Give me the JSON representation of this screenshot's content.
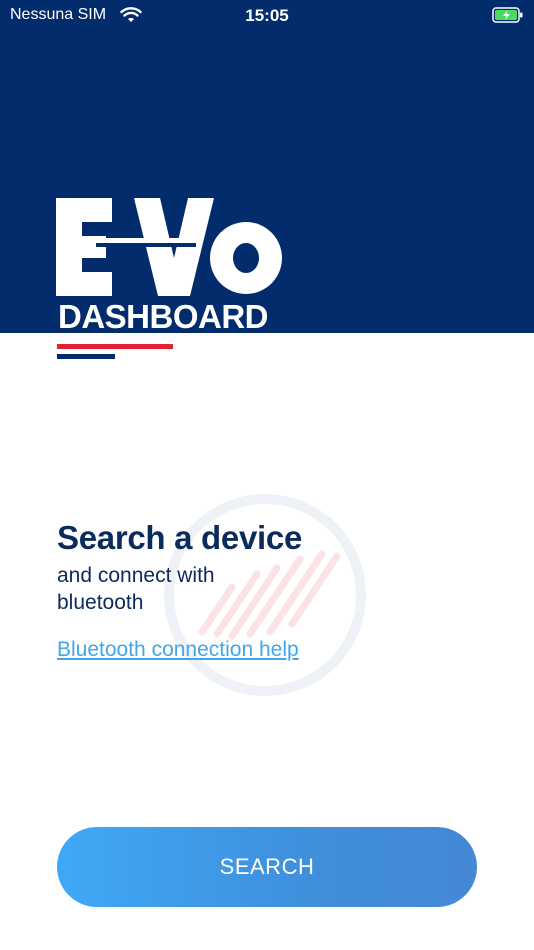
{
  "status_bar": {
    "carrier": "Nessuna SIM",
    "time": "15:05",
    "wifi_icon": "wifi-icon",
    "battery_icon": "battery-charging-icon"
  },
  "logo": {
    "word": "EVO",
    "sub": "DASHBOARD",
    "accent_red": "#e3202f",
    "brand_blue": "#022c6b"
  },
  "main": {
    "title": "Search a device",
    "subtitle": "and connect with bluetooth",
    "help_link": "Bluetooth connection help"
  },
  "search_button": {
    "label": "SEARCH"
  },
  "colors": {
    "header_bg": "#022c6b",
    "title_text": "#0b2b5c",
    "link": "#41a7ea",
    "button_start": "#3fa9f7",
    "button_end": "#4488d6"
  }
}
